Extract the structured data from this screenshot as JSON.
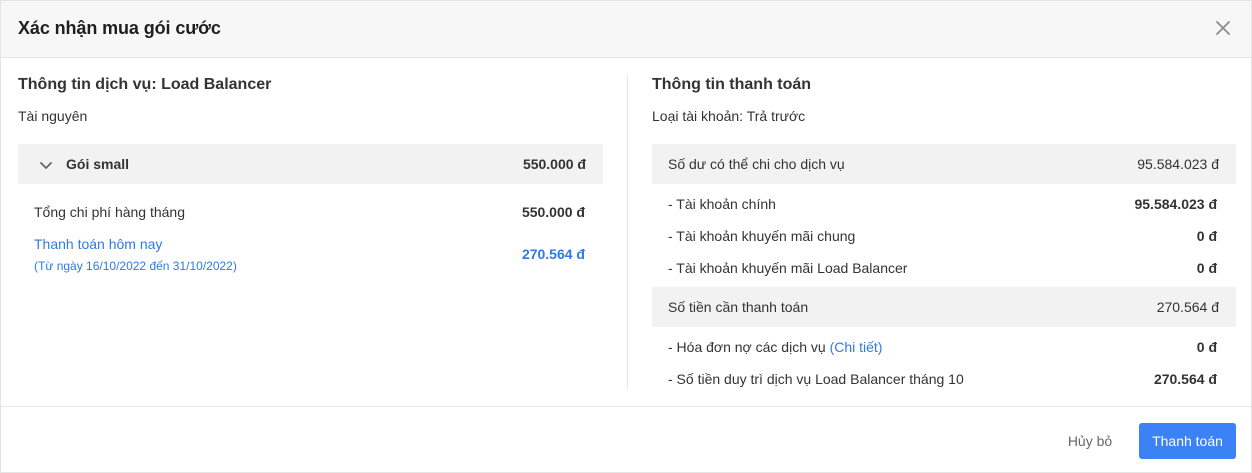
{
  "modal": {
    "title": "Xác nhận mua gói cước"
  },
  "service": {
    "title": "Thông tin dịch vụ: Load Balancer",
    "resource_label": "Tài nguyên",
    "package": {
      "name": "Gói small",
      "price": "550.000 đ"
    },
    "monthly_total_label": "Tổng chi phí hàng tháng",
    "monthly_total_value": "550.000 đ",
    "pay_today_label": "Thanh toán hôm nay",
    "pay_today_period": "(Từ ngày 16/10/2022 đến 31/10/2022)",
    "pay_today_value": "270.564 đ"
  },
  "payment": {
    "title": "Thông tin thanh toán",
    "account_type": "Loại tài khoản: Trả trước",
    "balance_label": "Số dư có thể chi cho dịch vụ",
    "balance_value": "95.584.023 đ",
    "main_account_label": "- Tài khoản chính",
    "main_account_value": "95.584.023 đ",
    "promo_common_label": "- Tài khoản khuyến mãi chung",
    "promo_common_value": "0 đ",
    "promo_lb_label": "- Tài khoản khuyến mãi Load Balancer",
    "promo_lb_value": "0 đ",
    "amount_due_label": "Số tiền cần thanh toán",
    "amount_due_value": "270.564 đ",
    "debt_label": "- Hóa đơn nợ các dịch vụ",
    "debt_link": "(Chi tiết)",
    "debt_value": "0 đ",
    "maintain_label": "- Số tiền duy trì dịch vụ Load Balancer tháng 10",
    "maintain_value": "270.564 đ"
  },
  "footer": {
    "cancel_label": "Hủy bỏ",
    "pay_label": "Thanh toán"
  },
  "colors": {
    "accent": "#3b82f6",
    "link": "#2f7ae5"
  },
  "icons": {
    "close": "close-icon",
    "chevron": "chevron-down-icon"
  }
}
